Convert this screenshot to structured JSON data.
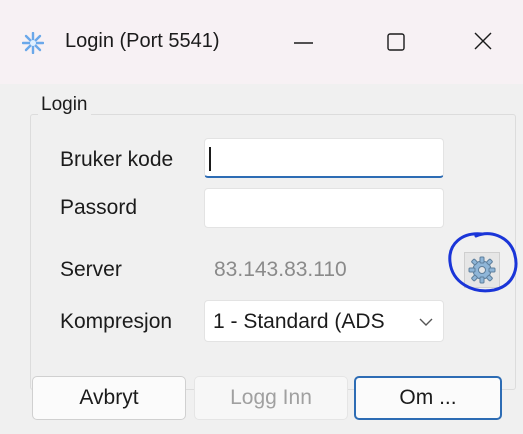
{
  "window": {
    "title": "Login (Port 5541)",
    "icon": "snowflake-icon"
  },
  "titlebar_buttons": {
    "minimize_icon": "minimize-icon",
    "maximize_icon": "maximize-icon",
    "close_icon": "close-icon"
  },
  "group": {
    "label": "Login"
  },
  "form": {
    "username_label": "Bruker kode",
    "username_value": "",
    "password_label": "Passord",
    "password_value": "",
    "server_label": "Server",
    "server_value": "83.143.83.110",
    "compression_label": "Kompresjon",
    "compression_value": "1 - Standard (ADS"
  },
  "buttons": {
    "cancel": "Avbryt",
    "login": "Logg Inn",
    "about": "Om ..."
  },
  "colors": {
    "accent": "#2d6cb4",
    "annotation": "#1a35d8"
  }
}
